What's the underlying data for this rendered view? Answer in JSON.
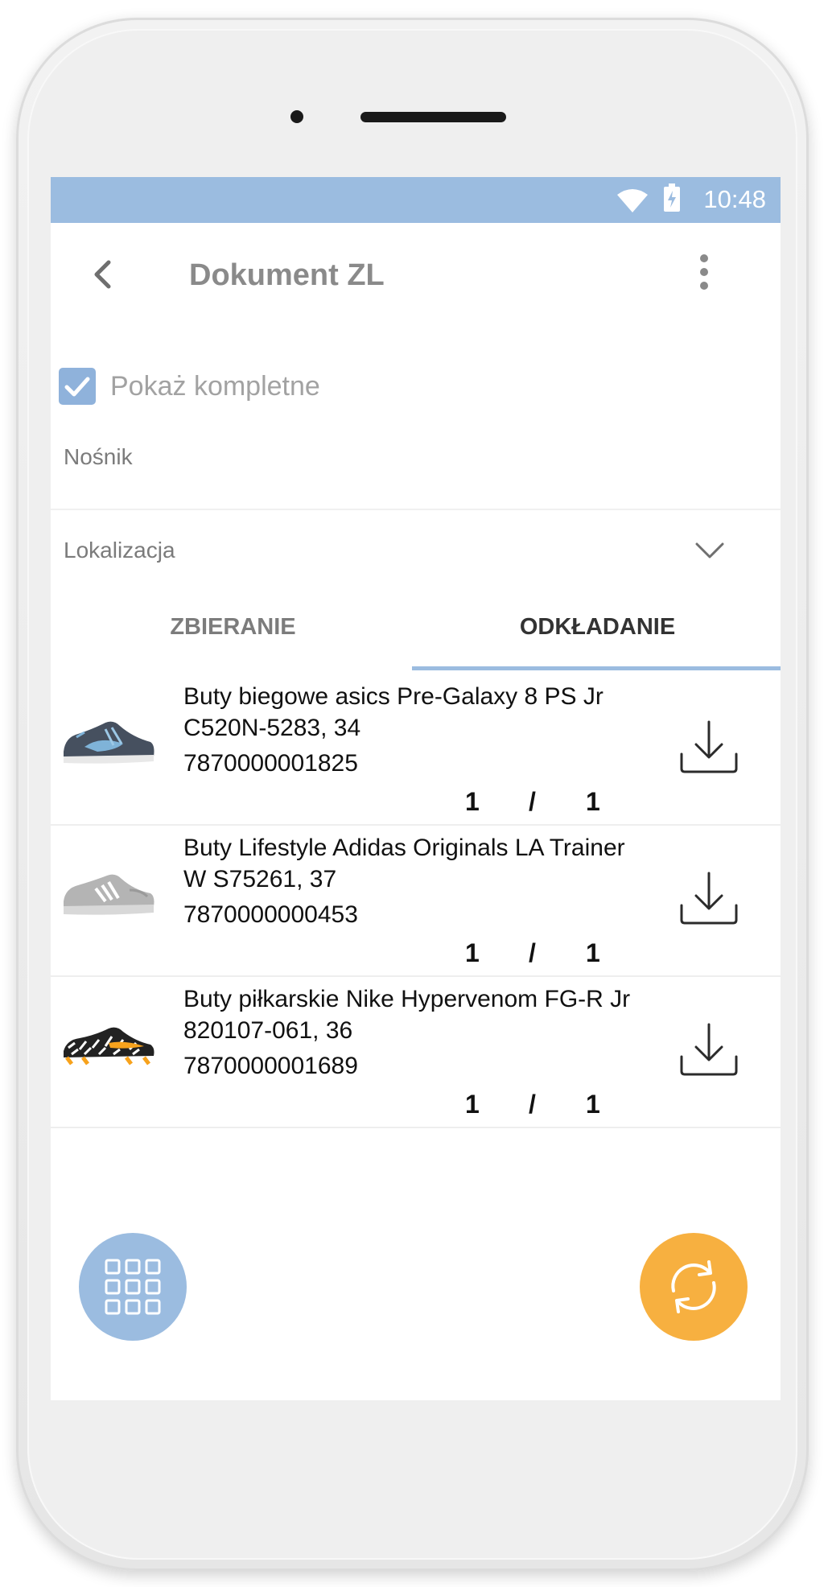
{
  "status_bar": {
    "time": "10:48",
    "wifi_icon": "wifi-icon",
    "battery_icon": "battery-charging-icon",
    "color": "#9bbce0"
  },
  "app_bar": {
    "title": "Dokument ZL",
    "back_icon": "back-arrow-icon",
    "more_icon": "more-vert-icon"
  },
  "filters": {
    "show_complete_label": "Pokaż kompletne",
    "show_complete_checked": true,
    "carrier_label": "Nośnik",
    "location_label": "Lokalizacja"
  },
  "tabs": [
    {
      "label": "ZBIERANIE",
      "active": false
    },
    {
      "label": "ODKŁADANIE",
      "active": true
    }
  ],
  "items": [
    {
      "name": "Buty biegowe asics Pre-Galaxy 8 PS Jr C520N-5283, 34",
      "code": "7870000001825",
      "qty_done": "1",
      "separator": "/",
      "qty_total": "1",
      "image": "shoe-asics-grey-blue"
    },
    {
      "name": "Buty Lifestyle Adidas Originals LA Trainer W S75261, 37",
      "code": "7870000000453",
      "qty_done": "1",
      "separator": "/",
      "qty_total": "1",
      "image": "shoe-adidas-grey"
    },
    {
      "name": "Buty piłkarskie Nike Hypervenom FG-R Jr 820107-061, 36",
      "code": "7870000001689",
      "qty_done": "1",
      "separator": "/",
      "qty_total": "1",
      "image": "shoe-nike-football"
    }
  ],
  "fabs": {
    "grid_icon": "grid-icon",
    "grid_color": "#9bbce0",
    "refresh_icon": "refresh-icon",
    "refresh_color": "#f7b040"
  }
}
